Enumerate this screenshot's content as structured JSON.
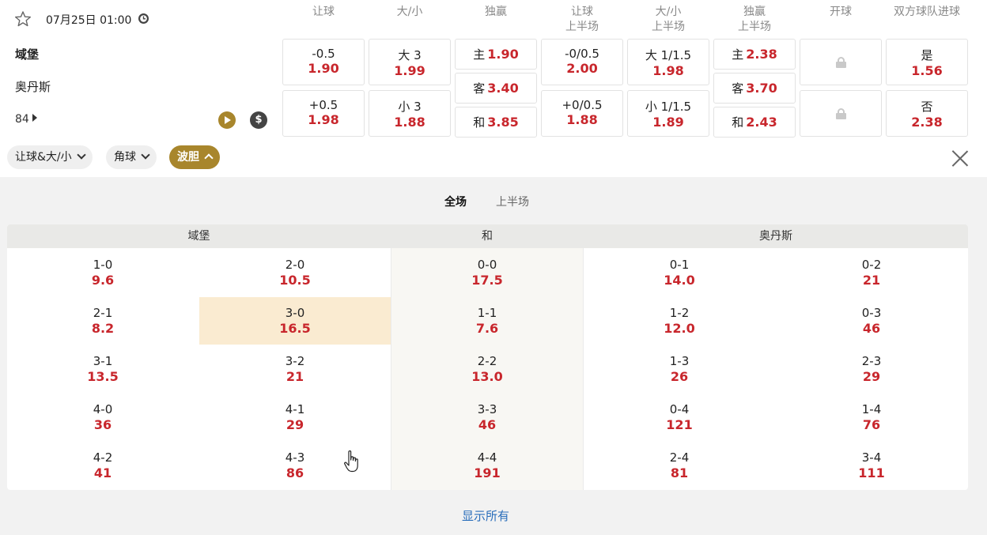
{
  "match": {
    "datetime": "07月25日 01:00",
    "home": "域堡",
    "away": "奥丹斯",
    "minute": "84"
  },
  "headers": [
    {
      "line1": "让球",
      "line2": ""
    },
    {
      "line1": "大/小",
      "line2": ""
    },
    {
      "line1": "独赢",
      "line2": ""
    },
    {
      "line1": "让球",
      "line2": "上半场"
    },
    {
      "line1": "大/小",
      "line2": "上半场"
    },
    {
      "line1": "独赢",
      "line2": "上半场"
    },
    {
      "line1": "开球",
      "line2": ""
    },
    {
      "line1": "双方球队进球",
      "line2": ""
    }
  ],
  "markets": {
    "handicap": [
      {
        "label": "-0.5",
        "odds": "1.90"
      },
      {
        "label": "+0.5",
        "odds": "1.98"
      }
    ],
    "overunder": [
      {
        "label": "大 3",
        "odds": "1.99"
      },
      {
        "label": "小 3",
        "odds": "1.88"
      }
    ],
    "moneyline": [
      {
        "label": "主",
        "odds": "1.90"
      },
      {
        "label": "客",
        "odds": "3.40"
      },
      {
        "label": "和",
        "odds": "3.85"
      }
    ],
    "handicap_1h": [
      {
        "label": "-0/0.5",
        "odds": "2.00"
      },
      {
        "label": "+0/0.5",
        "odds": "1.88"
      }
    ],
    "overunder_1h": [
      {
        "label": "大 1/1.5",
        "odds": "1.98"
      },
      {
        "label": "小 1/1.5",
        "odds": "1.89"
      }
    ],
    "moneyline_1h": [
      {
        "label": "主",
        "odds": "2.38"
      },
      {
        "label": "客",
        "odds": "3.70"
      },
      {
        "label": "和",
        "odds": "2.43"
      }
    ],
    "btts": [
      {
        "label": "是",
        "odds": "1.56"
      },
      {
        "label": "否",
        "odds": "2.38"
      }
    ]
  },
  "filters": [
    {
      "label": "让球&大/小",
      "active": false
    },
    {
      "label": "角球",
      "active": false
    },
    {
      "label": "波胆",
      "active": true
    }
  ],
  "correct_score": {
    "period_tabs": [
      "全场",
      "上半场"
    ],
    "groups": [
      "域堡",
      "和",
      "奥丹斯"
    ],
    "home_col1": [
      {
        "score": "1-0",
        "odds": "9.6"
      },
      {
        "score": "2-1",
        "odds": "8.2"
      },
      {
        "score": "3-1",
        "odds": "13.5"
      },
      {
        "score": "4-0",
        "odds": "36"
      },
      {
        "score": "4-2",
        "odds": "41"
      }
    ],
    "home_col2": [
      {
        "score": "2-0",
        "odds": "10.5"
      },
      {
        "score": "3-0",
        "odds": "16.5"
      },
      {
        "score": "3-2",
        "odds": "21"
      },
      {
        "score": "4-1",
        "odds": "29"
      },
      {
        "score": "4-3",
        "odds": "86"
      }
    ],
    "draw": [
      {
        "score": "0-0",
        "odds": "17.5"
      },
      {
        "score": "1-1",
        "odds": "7.6"
      },
      {
        "score": "2-2",
        "odds": "13.0"
      },
      {
        "score": "3-3",
        "odds": "46"
      },
      {
        "score": "4-4",
        "odds": "191"
      }
    ],
    "away_col1": [
      {
        "score": "0-1",
        "odds": "14.0"
      },
      {
        "score": "1-2",
        "odds": "12.0"
      },
      {
        "score": "1-3",
        "odds": "26"
      },
      {
        "score": "0-4",
        "odds": "121"
      },
      {
        "score": "2-4",
        "odds": "81"
      }
    ],
    "away_col2": [
      {
        "score": "0-2",
        "odds": "21"
      },
      {
        "score": "0-3",
        "odds": "46"
      },
      {
        "score": "2-3",
        "odds": "29"
      },
      {
        "score": "1-4",
        "odds": "76"
      },
      {
        "score": "3-4",
        "odds": "111"
      }
    ],
    "show_all": "显示所有"
  },
  "colors": {
    "odds": "#c8262c",
    "accent": "#a8862c",
    "highlight": "#faebd1",
    "link": "#2a6ebb"
  },
  "icons": [
    "star-icon",
    "clock-icon",
    "play-icon",
    "dollar-icon",
    "lock-icon",
    "chevron-down-icon",
    "chevron-up-icon",
    "close-icon",
    "hand-cursor-icon"
  ]
}
